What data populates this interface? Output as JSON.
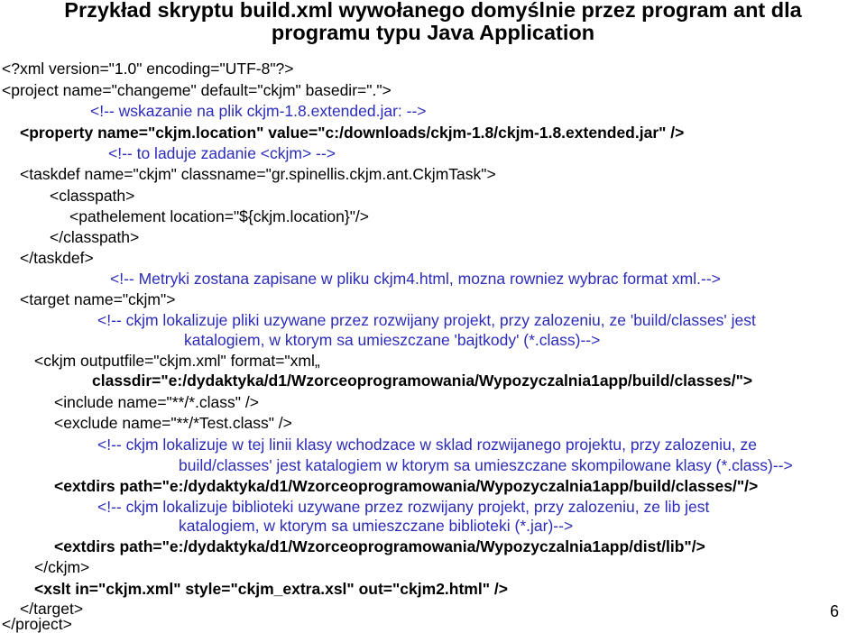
{
  "title": {
    "line1": "Przykład skryptu build.xml wywołanego domyślnie przez program ant dla",
    "line2": "programu typu Java Application"
  },
  "code_lines": [
    "<?xml version=\"1.0\" encoding=\"UTF-8\"?>",
    "<project name=\"changeme\" default=\"ckjm\" basedir=\".\">",
    "<!-- wskazanie na plik ckjm-1.8.extended.jar: -->",
    "<property name=\"ckjm.location\" value=\"c:/downloads/ckjm-1.8/ckjm-1.8.extended.jar\" />",
    "<!-- to laduje zadanie <ckjm> -->",
    "<taskdef name=\"ckjm\" classname=\"gr.spinellis.ckjm.ant.CkjmTask\">",
    "<classpath>",
    "<pathelement location=\"${ckjm.location}\"/>",
    "</classpath>",
    "</taskdef>",
    "<!-- Metryki zostana zapisane w pliku ckjm4.html, mozna rowniez wybrac format xml.-->",
    "<target name=\"ckjm\">",
    "<!-- ckjm lokalizuje pliki uzywane przez rozwijany projekt, przy zalozeniu, ze 'build/classes' jest",
    "katalogiem, w ktorym sa umieszczane 'bajtkody' (*.class)-->",
    "<ckjm outputfile=\"ckjm.xml\" format=\"xml„",
    "classdir=\"e:/dydaktyka/d1/Wzorceoprogramowania/Wypozyczalnia1app/build/classes/\">",
    "<include name=\"**/*.class\" />",
    "<exclude name=\"**/*Test.class\" />",
    "<!-- ckjm lokalizuje w tej linii klasy wchodzace w sklad rozwijanego projektu, przy zalozeniu, ze",
    "build/classes' jest katalogiem w ktorym sa umieszczane skompilowane klasy (*.class)-->",
    "<extdirs path=\"e:/dydaktyka/d1/Wzorceoprogramowania/Wypozyczalnia1app/build/classes/\"/>",
    "<!-- ckjm lokalizuje biblioteki uzywane przez rozwijany projekt, przy zalozeniu, ze lib jest",
    "katalogiem, w ktorym sa umieszczane biblioteki (*.jar)-->",
    "<extdirs path=\"e:/dydaktyka/d1/Wzorceoprogramowania/Wypozyczalnia1app/dist/lib\"/>",
    "</ckjm>",
    "<xslt in=\"ckjm.xml\" style=\"ckjm_extra.xsl\" out=\"ckjm2.html\" />",
    "</target>",
    "</project>"
  ],
  "page_number": "6",
  "colors": {
    "comment": "#2b2bb8",
    "text": "#000000",
    "background": "#ffffff"
  }
}
